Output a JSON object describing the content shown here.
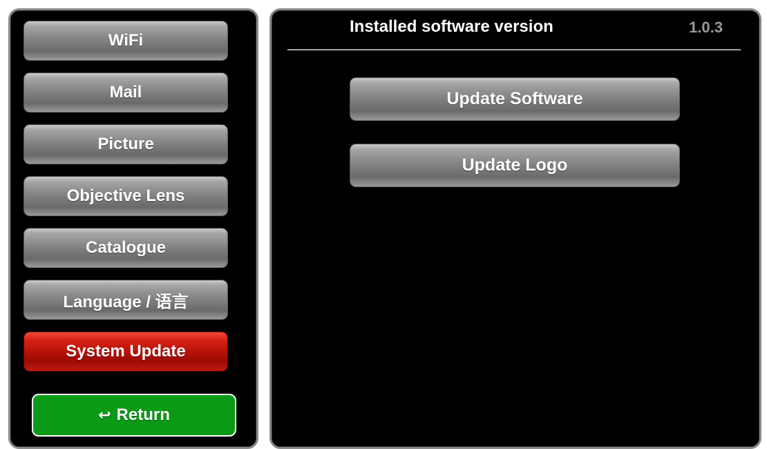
{
  "sidebar": {
    "items": [
      {
        "label": "WiFi"
      },
      {
        "label": "Mail"
      },
      {
        "label": "Picture"
      },
      {
        "label": "Objective Lens"
      },
      {
        "label": "Catalogue"
      },
      {
        "label": "Language / 语言"
      },
      {
        "label": "System Update",
        "selected": true
      }
    ],
    "return_label": "Return",
    "return_icon": "return-arrow-icon"
  },
  "main": {
    "header": {
      "title": "Installed software version",
      "version": "1.0.3"
    },
    "buttons": {
      "update_software": "Update Software",
      "update_logo": "Update Logo"
    }
  },
  "colors": {
    "selected_item": "#b81208",
    "return_button": "#0a9a16",
    "background": "#000000",
    "panel_border": "#8a8a8a"
  }
}
